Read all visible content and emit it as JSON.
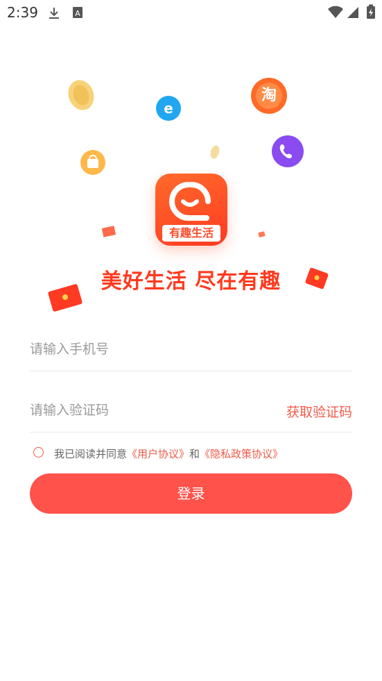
{
  "status_bar": {
    "time": "2:39"
  },
  "hero": {
    "app_logo_label": "有趣生活",
    "slogan": "美好生活 尽在有趣",
    "taobao_badge": "淘"
  },
  "form": {
    "phone_placeholder": "请输入手机号",
    "code_placeholder": "请输入验证码",
    "get_code_label": "获取验证码"
  },
  "agreement": {
    "prefix": "我已阅读并同意",
    "user_agreement": "《用户协议》",
    "and": "和",
    "privacy_policy": "《隐私政策协议》"
  },
  "login_button": "登录",
  "colors": {
    "accent": "#ff524b",
    "link": "#f05a48",
    "slogan": "#ff3a1f"
  }
}
